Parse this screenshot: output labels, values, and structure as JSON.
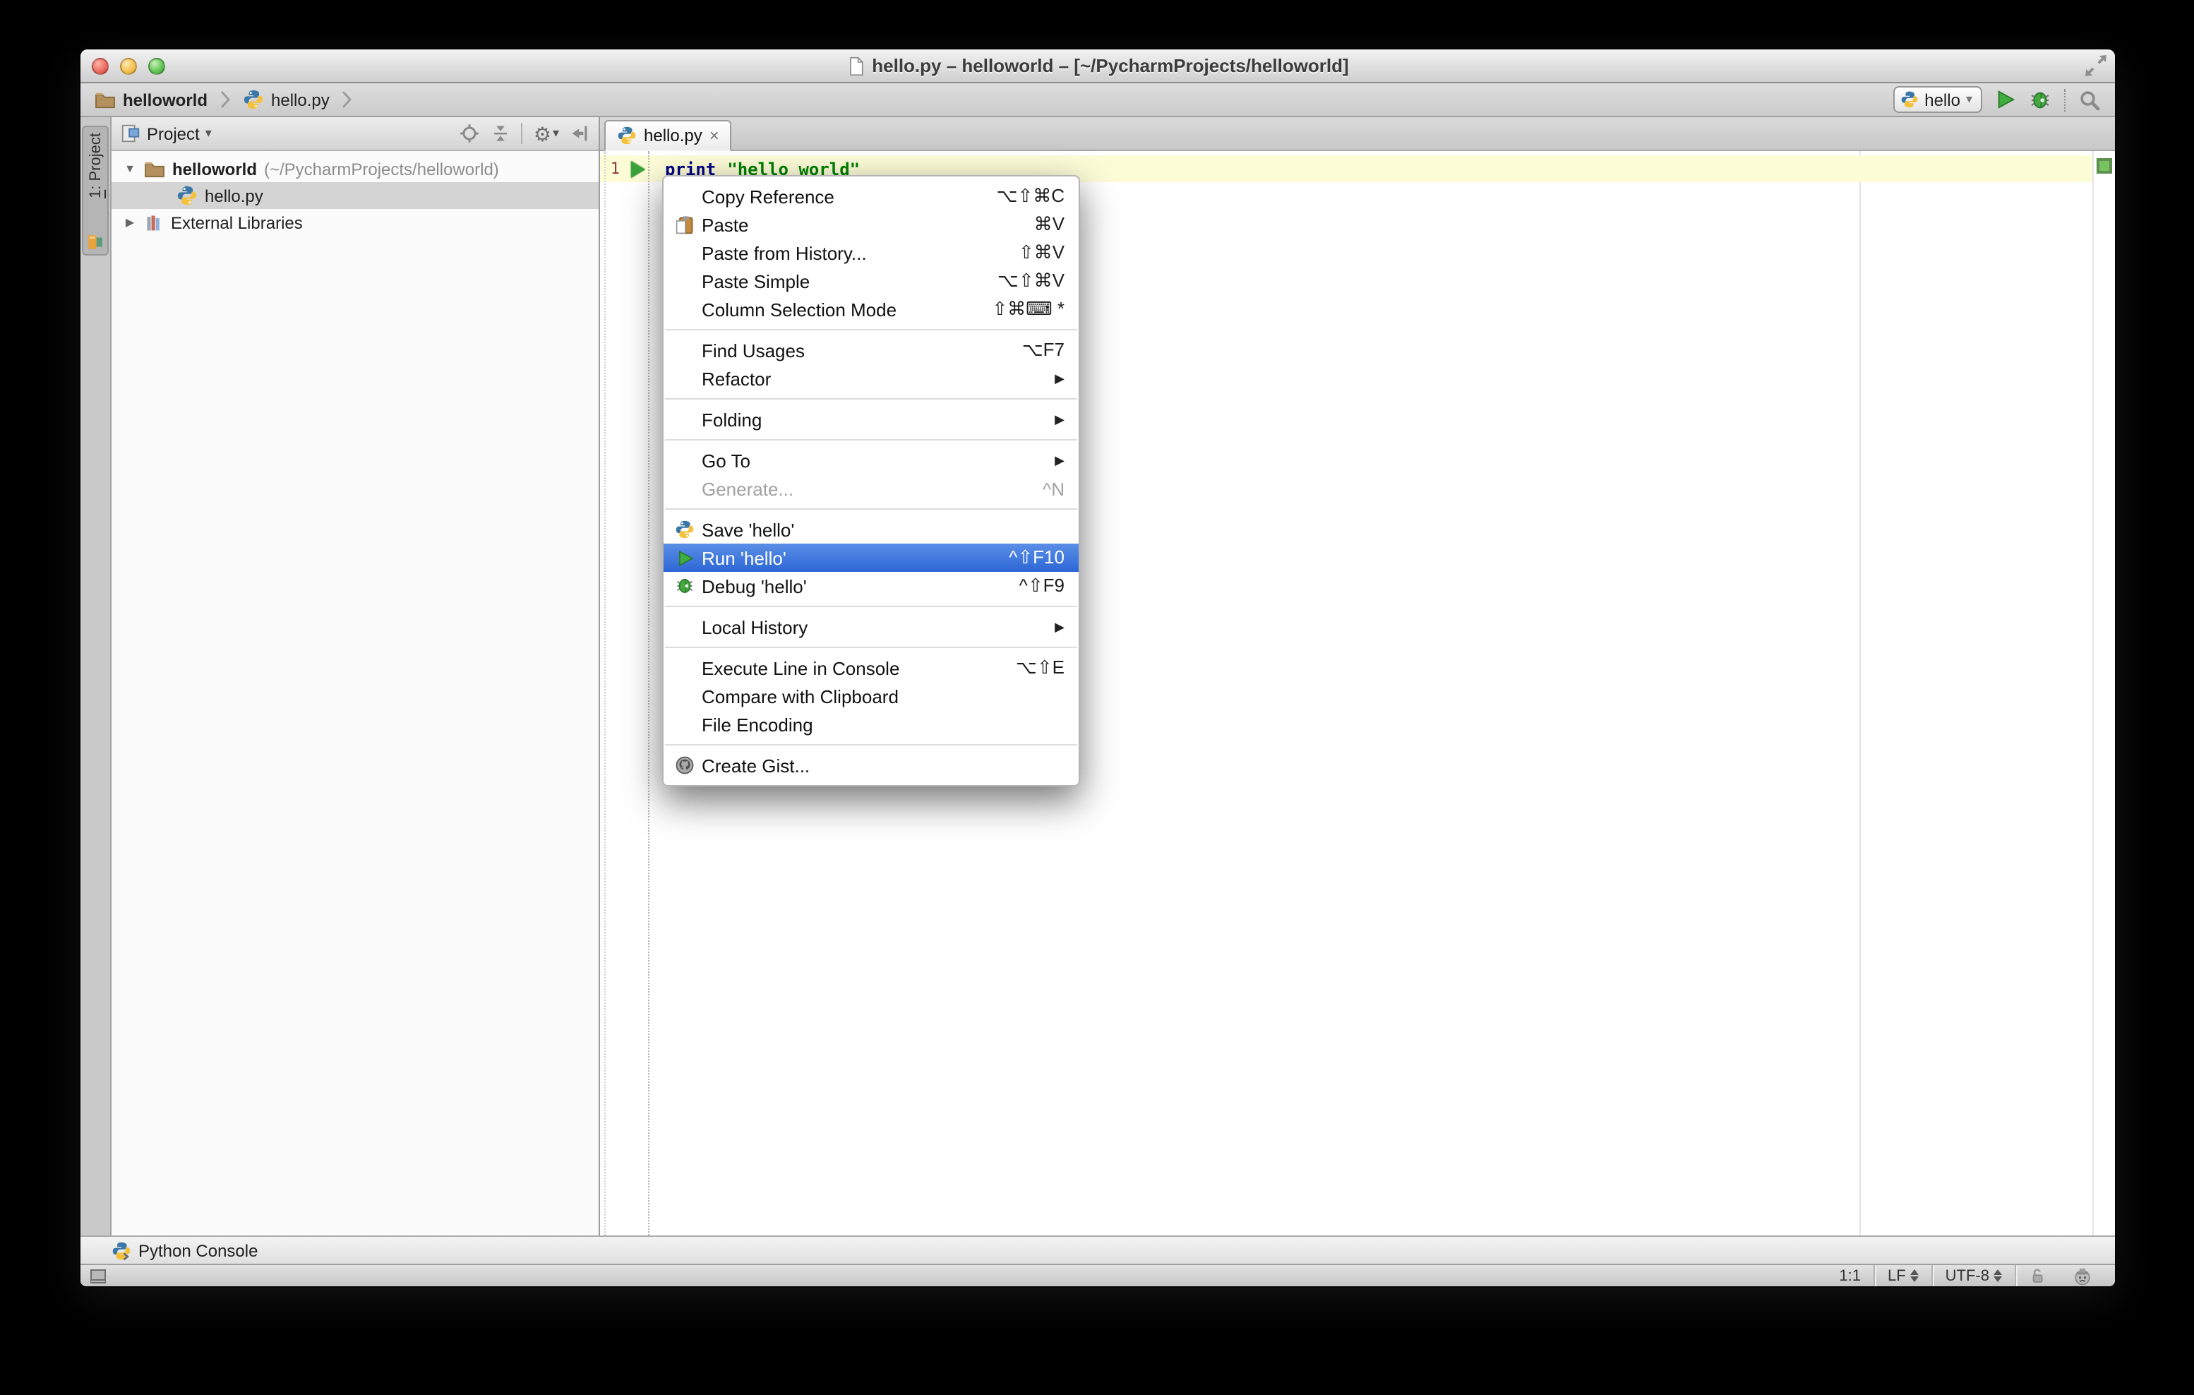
{
  "icons": {
    "caret_down": "▾",
    "tree_expanded": "▼",
    "tree_collapsed": "▶",
    "submenu_arrow": "▶",
    "close": "×",
    "gear": "⚙"
  },
  "window": {
    "title": "hello.py – helloworld – [~/PycharmProjects/helloworld]"
  },
  "navbar": {
    "breadcrumb_project": "helloworld",
    "breadcrumb_file": "hello.py",
    "run_config": "hello"
  },
  "stripe": {
    "tab_number": "1",
    "tab_rest": ": Project"
  },
  "project_panel": {
    "title": "Project",
    "tree": {
      "root_name": "helloworld",
      "root_path": "(~/PycharmProjects/helloworld)",
      "file": "hello.py",
      "external": "External Libraries"
    }
  },
  "editor": {
    "tab_title": "hello.py",
    "line_number": "1",
    "code_keyword": "print",
    "code_string": "\"hello world\""
  },
  "context_menu": {
    "items": [
      {
        "label": "Copy Reference",
        "shortcut": "⌥⇧⌘C"
      },
      {
        "label": "Paste",
        "shortcut": "⌘V"
      },
      {
        "label": "Paste from History...",
        "shortcut": "⇧⌘V"
      },
      {
        "label": "Paste Simple",
        "shortcut": "⌥⇧⌘V"
      },
      {
        "label": "Column Selection Mode",
        "shortcut": "⇧⌘⌨ *"
      },
      {
        "label": "Find Usages",
        "shortcut": "⌥F7"
      },
      {
        "label": "Refactor",
        "shortcut": ""
      },
      {
        "label": "Folding",
        "shortcut": ""
      },
      {
        "label": "Go To",
        "shortcut": ""
      },
      {
        "label": "Generate...",
        "shortcut": "^N"
      },
      {
        "label": "Save 'hello'",
        "shortcut": ""
      },
      {
        "label": "Run 'hello'",
        "shortcut": "^⇧F10"
      },
      {
        "label": "Debug 'hello'",
        "shortcut": "^⇧F9"
      },
      {
        "label": "Local History",
        "shortcut": ""
      },
      {
        "label": "Execute Line in Console",
        "shortcut": "⌥⇧E"
      },
      {
        "label": "Compare with Clipboard",
        "shortcut": ""
      },
      {
        "label": "File Encoding",
        "shortcut": ""
      },
      {
        "label": "Create Gist...",
        "shortcut": ""
      }
    ]
  },
  "console_bar": {
    "label": "Python Console"
  },
  "status_bar": {
    "caret_position": "1:1",
    "line_separator": "LF",
    "encoding": "UTF-8"
  }
}
